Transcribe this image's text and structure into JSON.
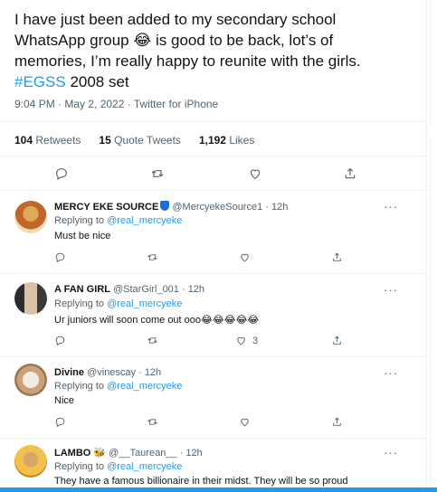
{
  "tweet": {
    "text_line1": "I have just been added to my secondary school",
    "text_line2_a": "WhatsApp group",
    "emoji_main": "😂",
    "text_line2_b": "is good to be back, lot’s of",
    "text_line3": "memories, I’m really happy to reunite with the girls.",
    "hashtag": "#EGSS",
    "text_line4_rest": "2008 set",
    "meta": "9:04 PM · May 2, 2022 · Twitter for iPhone",
    "retweets_count": "104",
    "retweets_label": "Retweets",
    "quotes_count": "15",
    "quotes_label": "Quote Tweets",
    "likes_count": "1,192",
    "likes_label": "Likes"
  },
  "replies": [
    {
      "name": "MERCY EKE SOURCE",
      "handle": "@MercyekeSource1 · 12h",
      "replying_prefix": "Replying to",
      "mention": "@real_mercyeke",
      "text": "Must be nice",
      "like_count": ""
    },
    {
      "name": "A FAN GIRL",
      "handle": "@StarGirl_001 · 12h",
      "replying_prefix": "Replying to",
      "mention": "@real_mercyeke",
      "text": "Ur juniors will soon come out ooo😂😂😂😂😂",
      "like_count": "3"
    },
    {
      "name": "Divine",
      "handle": "@vinescay · 12h",
      "replying_prefix": "Replying to",
      "mention": "@real_mercyeke",
      "text": "Nice",
      "like_count": ""
    },
    {
      "name": "LAMBO 🐝",
      "handle": "@__Taurean__ · 12h",
      "replying_prefix": "Replying to",
      "mention": "@real_mercyeke",
      "text": "They have a famous billionaire in their midst. They will be so proud",
      "like_count": ""
    }
  ],
  "more_label": "···",
  "colors": {
    "accent": "#1d9bf0",
    "text": "#0f1419",
    "muted": "#536471",
    "border": "#eff3f4"
  }
}
